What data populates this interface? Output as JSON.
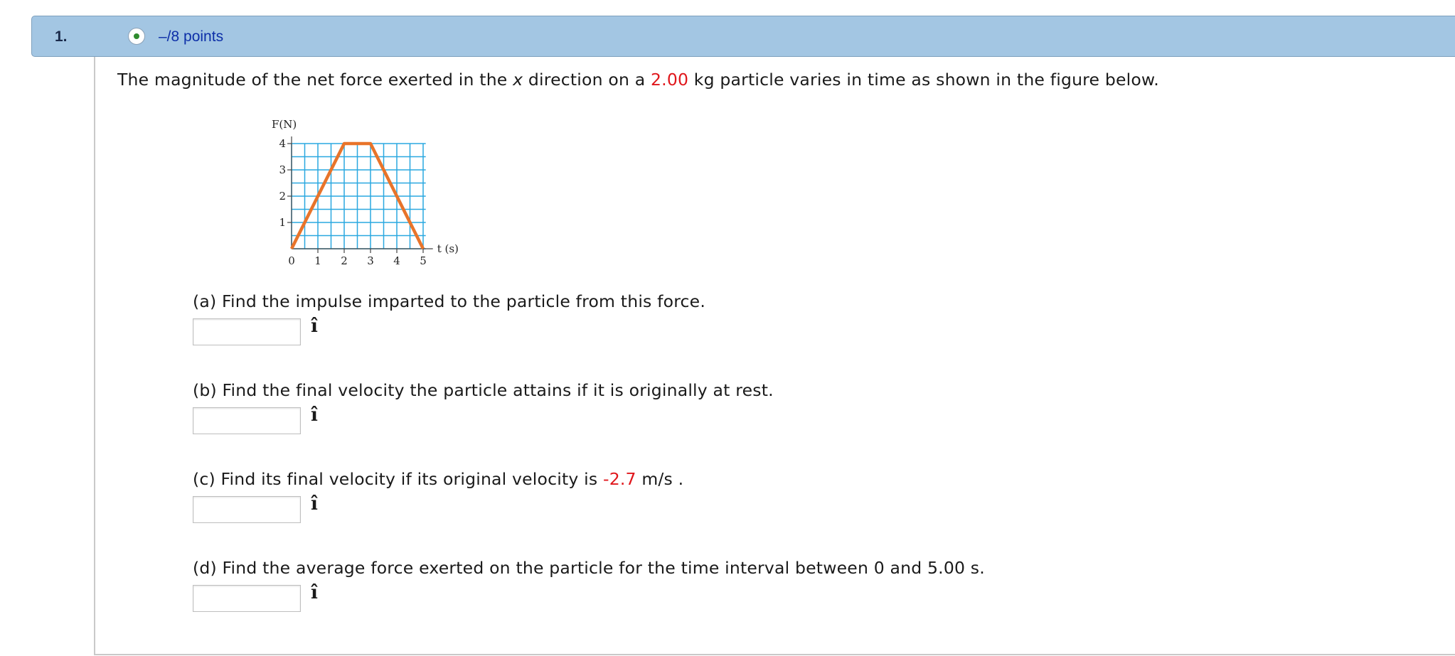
{
  "question": {
    "number": "1.",
    "points": "–/8 points",
    "intro": {
      "pre": "The magnitude of the net force exerted in the ",
      "var": "x",
      "mid": " direction on a ",
      "mass": "2.00",
      "post": " kg particle varies in time as shown in the figure below."
    },
    "parts": [
      {
        "text": "(a) Find the impulse imparted to the particle from this force.",
        "answer": "",
        "unit": "î"
      },
      {
        "text": "(b) Find the final velocity the particle attains if it is originally at rest.",
        "answer": "",
        "unit": "î"
      },
      {
        "pre": "(c) Find its final velocity if its original velocity is ",
        "value": "-2.7",
        "post": " m/s .",
        "answer": "",
        "unit": "î"
      },
      {
        "text": "(d) Find the average force exerted on the particle for the time interval between 0 and 5.00 s.",
        "answer": "",
        "unit": "î"
      }
    ]
  },
  "colors": {
    "header_bg": "#a3c6e3",
    "points_text": "#0d2fa8",
    "highlight": "#e0161b",
    "grid": "#2aa8e0",
    "curve": "#e8742a"
  },
  "chart_data": {
    "type": "line",
    "ylabel": "F(N)",
    "xlabel": "t (s)",
    "xlim": [
      0,
      6
    ],
    "ylim": [
      0,
      4
    ],
    "x_ticks": [
      "0",
      "1",
      "2",
      "3",
      "4",
      "5"
    ],
    "y_ticks": [
      "1",
      "2",
      "3",
      "4"
    ],
    "grid": true,
    "series": [
      {
        "x": [
          0,
          2,
          3,
          5
        ],
        "y": [
          0,
          4,
          4,
          0
        ]
      }
    ]
  }
}
